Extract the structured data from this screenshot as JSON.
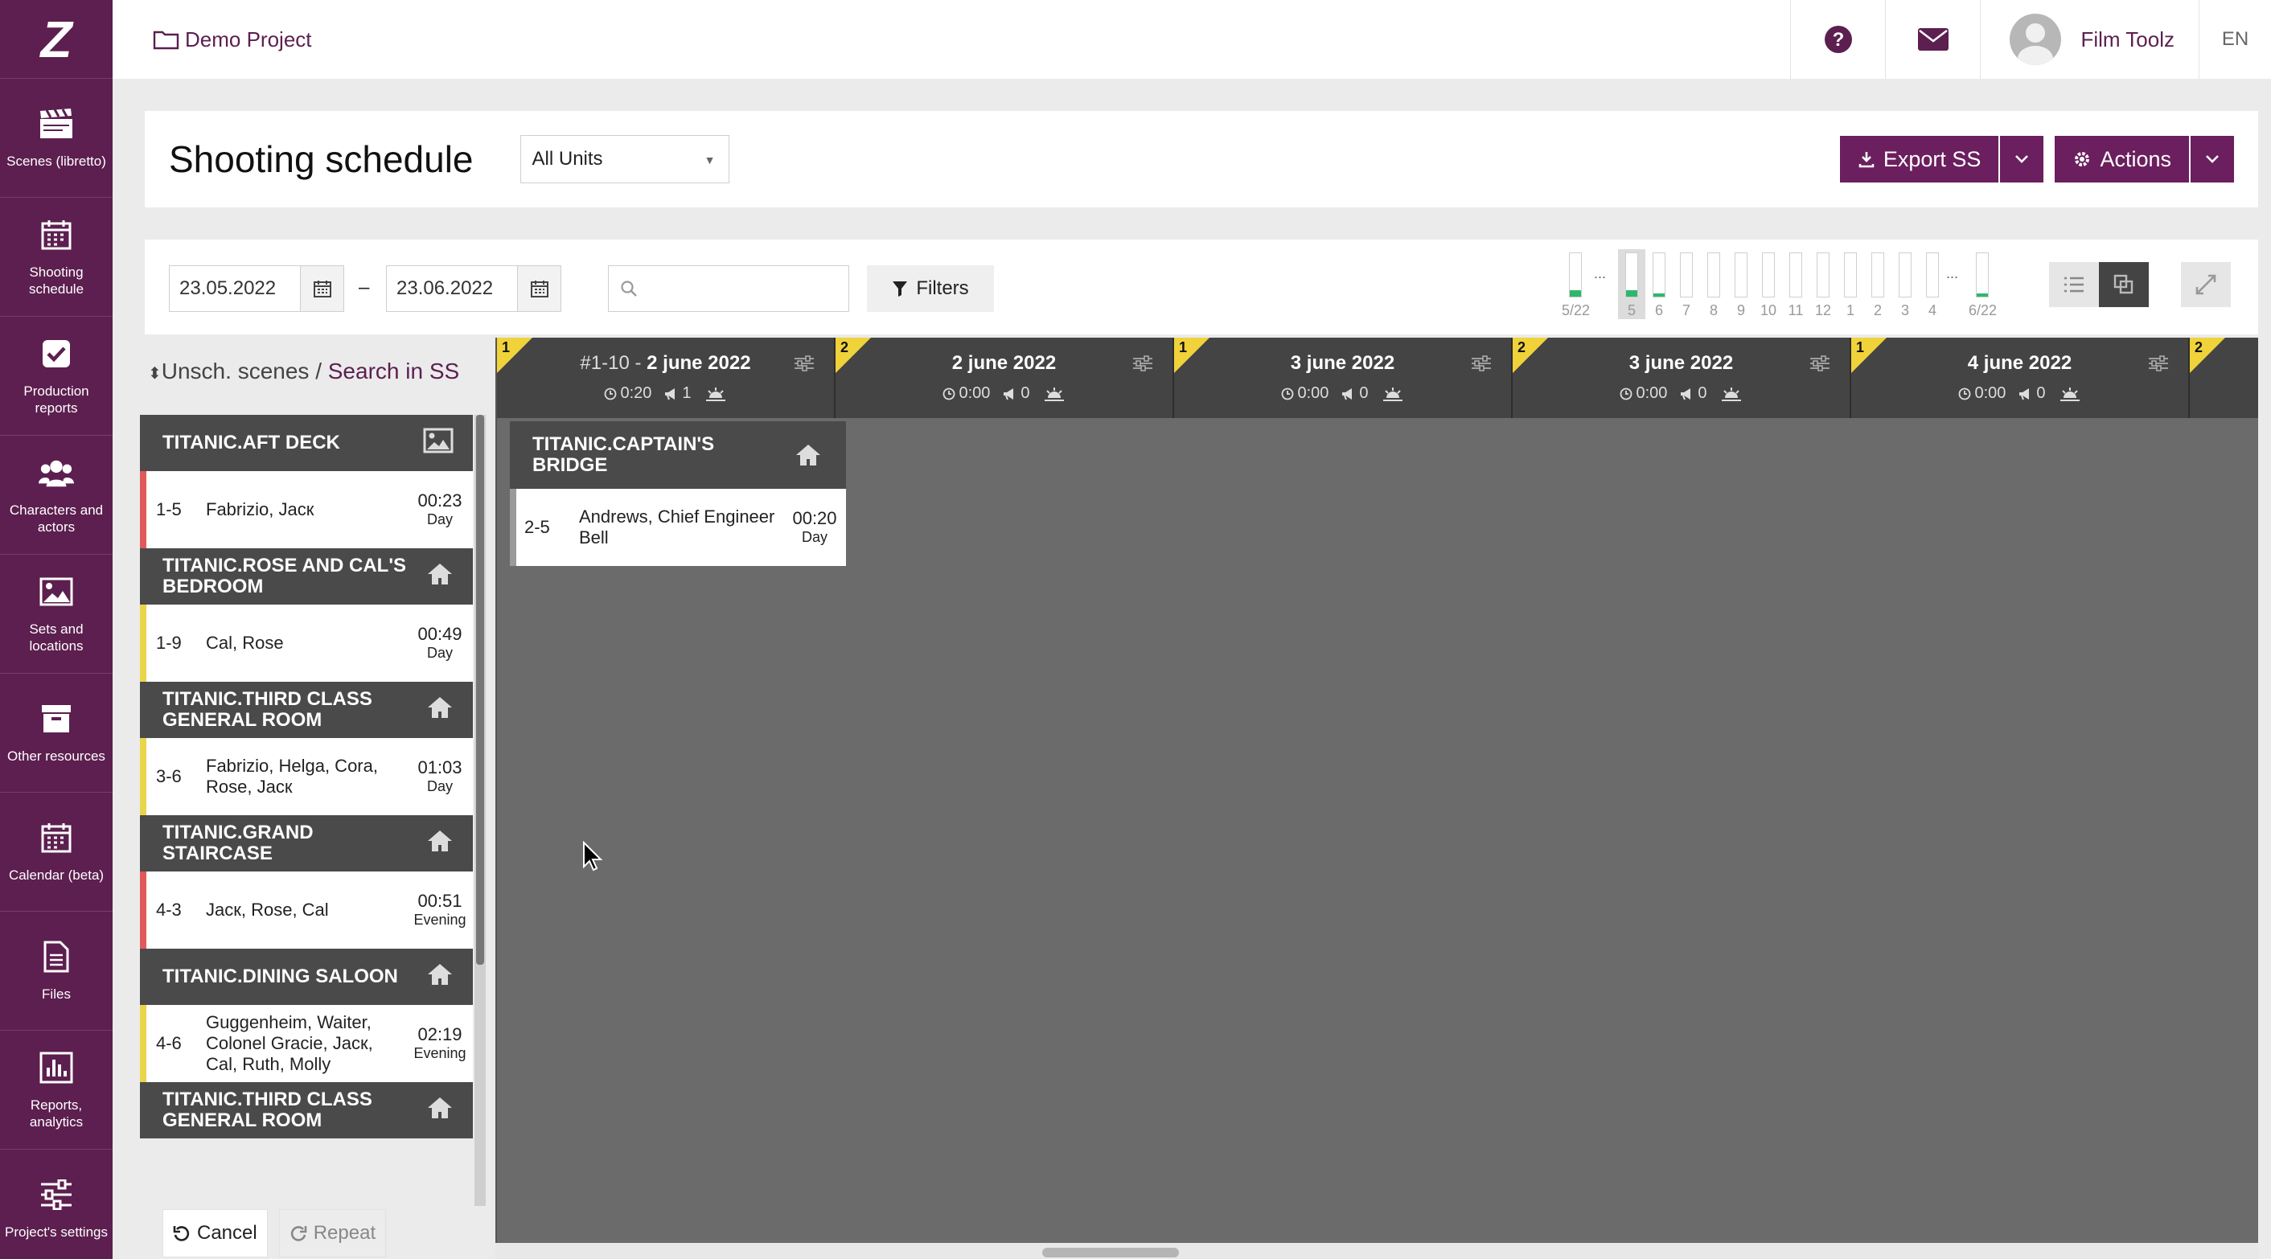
{
  "sidebar": {
    "logo": "Z",
    "items": [
      {
        "label": "Scenes (libretto)",
        "icon": "clapperboard-icon"
      },
      {
        "label": "Shooting schedule",
        "icon": "calendar-icon"
      },
      {
        "label": "Production reports",
        "icon": "checkbox-icon"
      },
      {
        "label": "Characters and actors",
        "icon": "users-icon"
      },
      {
        "label": "Sets and locations",
        "icon": "image-icon"
      },
      {
        "label": "Other resources",
        "icon": "archive-icon"
      },
      {
        "label": "Calendar (beta)",
        "icon": "calendar-icon"
      },
      {
        "label": "Files",
        "icon": "file-icon"
      },
      {
        "label": "Reports, analytics",
        "icon": "bar-chart-icon"
      },
      {
        "label": "Project's settings",
        "icon": "sliders-icon"
      }
    ]
  },
  "header": {
    "project": "Demo Project",
    "user": "Film Toolz",
    "lang": "EN"
  },
  "title": {
    "heading": "Shooting schedule",
    "unit_select": "All Units",
    "export_label": "Export SS",
    "actions_label": "Actions"
  },
  "filters": {
    "date_from": "23.05.2022",
    "date_sep": "–",
    "date_to": "23.06.2022",
    "search_placeholder": "",
    "filters_label": "Filters",
    "day_bars": [
      {
        "label": "5/22",
        "fill": 0.15,
        "selected": false
      },
      {
        "label": "5",
        "fill": 0.15,
        "selected": true
      },
      {
        "label": "6",
        "fill": 0.08,
        "selected": false
      },
      {
        "label": "7",
        "fill": 0,
        "selected": false
      },
      {
        "label": "8",
        "fill": 0,
        "selected": false
      },
      {
        "label": "9",
        "fill": 0,
        "selected": false
      },
      {
        "label": "10",
        "fill": 0,
        "selected": false
      },
      {
        "label": "11",
        "fill": 0,
        "selected": false
      },
      {
        "label": "12",
        "fill": 0,
        "selected": false
      },
      {
        "label": "1",
        "fill": 0,
        "selected": false
      },
      {
        "label": "2",
        "fill": 0,
        "selected": false
      },
      {
        "label": "3",
        "fill": 0,
        "selected": false
      },
      {
        "label": "4",
        "fill": 0,
        "selected": false
      },
      {
        "label": "6/22",
        "fill": 0.08,
        "selected": false
      }
    ],
    "ellipsis": "..."
  },
  "unscheduled": {
    "title": "Unsch. scenes",
    "separator": "/",
    "link": "Search in SS",
    "groups": [
      {
        "set": "TITANIC.AFT DECK",
        "icon": "image-icon",
        "scenes": [
          {
            "num": "1-5",
            "cast": "Fabrizio, Jacк",
            "time": "00:23",
            "period": "Day",
            "color": "red"
          }
        ]
      },
      {
        "set": "TITANIC.ROSE AND CAL'S BEDROOM",
        "icon": "home-icon",
        "scenes": [
          {
            "num": "1-9",
            "cast": "Cal, Rose",
            "time": "00:49",
            "period": "Day",
            "color": "yellow"
          }
        ]
      },
      {
        "set": "TITANIC.THIRD CLASS GENERAL ROOM",
        "icon": "home-icon",
        "scenes": [
          {
            "num": "3-6",
            "cast": "Fabrizio, Helga, Cora, Rose, Jacк",
            "time": "01:03",
            "period": "Day",
            "color": "yellow"
          }
        ]
      },
      {
        "set": "TITANIC.GRAND STAIRCASE",
        "icon": "home-icon",
        "scenes": [
          {
            "num": "4-3",
            "cast": "Jacк, Rose, Cal",
            "time": "00:51",
            "period": "Evening",
            "color": "red"
          }
        ]
      },
      {
        "set": "TITANIC.DINING SALOON",
        "icon": "home-icon",
        "scenes": [
          {
            "num": "4-6",
            "cast": "Guggenheim, Waiter, Colonel Gracie, Jacк, Cal, Ruth, Molly",
            "time": "02:19",
            "period": "Evening",
            "color": "yellow"
          }
        ]
      },
      {
        "set": "TITANIC.THIRD CLASS GENERAL ROOM",
        "icon": "home-icon",
        "scenes": []
      }
    ],
    "cancel_label": "Cancel",
    "repeat_label": "Repeat"
  },
  "board": {
    "days": [
      {
        "unit": "1",
        "prefix": "#1-10 - ",
        "date": "2 june 2022",
        "time": "0:20",
        "count": "1"
      },
      {
        "unit": "2",
        "prefix": "",
        "date": "2 june 2022",
        "time": "0:00",
        "count": "0"
      },
      {
        "unit": "1",
        "prefix": "",
        "date": "3 june 2022",
        "time": "0:00",
        "count": "0"
      },
      {
        "unit": "2",
        "prefix": "",
        "date": "3 june 2022",
        "time": "0:00",
        "count": "0"
      },
      {
        "unit": "1",
        "prefix": "",
        "date": "4 june 2022",
        "time": "0:00",
        "count": "0"
      },
      {
        "unit": "2",
        "prefix": "",
        "date": "",
        "time": "",
        "count": ""
      }
    ],
    "set": "TITANIC.CAPTAIN'S BRIDGE",
    "scene": {
      "num": "2-5",
      "cast": "Andrews, Chief Engineer Bell",
      "time": "00:20",
      "period": "Day"
    }
  },
  "colors": {
    "brand": "#5c1f4f",
    "accent": "#6b1f5e",
    "unit_flag": "#f0d23a",
    "progress": "#2fb66b"
  }
}
